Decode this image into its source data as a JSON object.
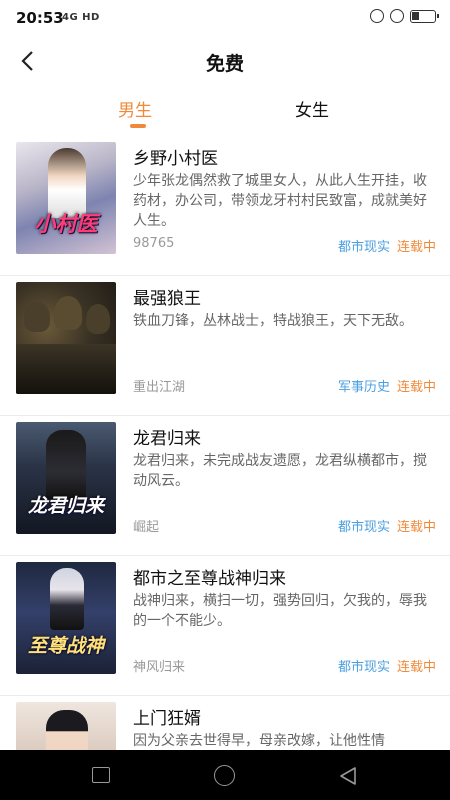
{
  "status_bar": {
    "time": "20:53",
    "network": "4G HD"
  },
  "header": {
    "title": "免费"
  },
  "tabs": [
    {
      "label": "男生",
      "active": true
    },
    {
      "label": "女生",
      "active": false
    }
  ],
  "colors": {
    "accent": "#f08a3a",
    "category": "#4a9fe0"
  },
  "books": [
    {
      "title": "乡野小村医",
      "description": "少年张龙偶然救了城里女人，从此人生开挂，收药材，办公司，带领龙牙村村民致富，成就美好人生。",
      "author": "98765",
      "category": "都市现实",
      "status": "连载中",
      "cover_text": "小村医"
    },
    {
      "title": "最强狼王",
      "description": "铁血刀锋，丛林战士，特战狼王，天下无敌。",
      "author": "重出江湖",
      "category": "军事历史",
      "status": "连载中",
      "cover_text": ""
    },
    {
      "title": "龙君归来",
      "description": "龙君归来，未完成战友遗愿，龙君纵横都市，搅动风云。",
      "author": "崛起",
      "category": "都市现实",
      "status": "连载中",
      "cover_text": "龙君归来"
    },
    {
      "title": "都市之至尊战神归来",
      "description": "战神归来，横扫一切，强势回归，欠我的，辱我的一个不能少。",
      "author": "神风归来",
      "category": "都市现实",
      "status": "连载中",
      "cover_text": "至尊战神"
    },
    {
      "title": "上门狂婿",
      "description": "因为父亲去世得早，母亲改嫁，让他性情",
      "author": "",
      "category": "",
      "status": "",
      "cover_text": ""
    }
  ]
}
